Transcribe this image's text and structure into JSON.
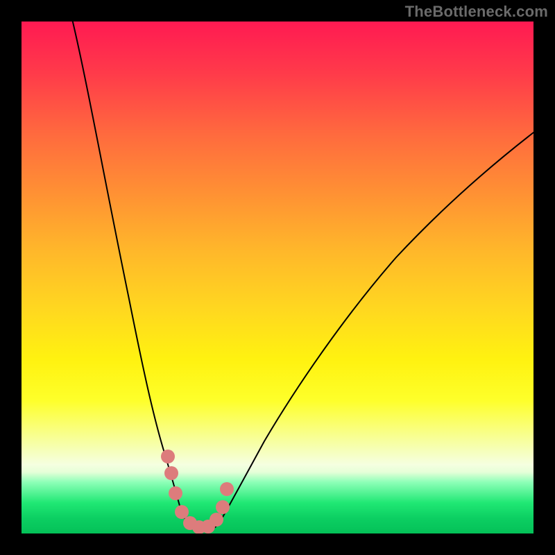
{
  "watermark": "TheBottleneck.com",
  "colors": {
    "frame_border": "#000000",
    "curve_stroke": "#000000",
    "marker_fill": "#dd7c7c",
    "gradient_top": "#ff1a52",
    "gradient_mid": "#fff210",
    "gradient_bottom": "#04c158"
  },
  "chart_data": {
    "type": "line",
    "title": "",
    "xlabel": "",
    "ylabel": "",
    "xlim": [
      0,
      100
    ],
    "ylim": [
      0,
      100
    ],
    "grid": false,
    "series": [
      {
        "name": "bottleneck-curve",
        "x": [
          10,
          12,
          14,
          16,
          18,
          20,
          22,
          24,
          26,
          28,
          29.5,
          31,
          33,
          35,
          37,
          40,
          45,
          50,
          55,
          60,
          65,
          70,
          75,
          80,
          85,
          90,
          95,
          100
        ],
        "values": [
          100,
          89,
          79,
          69,
          59,
          50,
          41,
          33,
          25,
          17,
          12,
          7,
          3,
          1,
          0.5,
          1,
          4,
          9,
          15,
          22,
          30,
          38,
          46,
          54,
          62,
          69,
          75,
          80
        ]
      }
    ],
    "markers": {
      "name": "highlighted-points",
      "x": [
        28,
        29,
        30,
        31.5,
        33,
        34.5,
        36,
        37.5,
        38.5,
        39
      ],
      "values": [
        16,
        12.5,
        8,
        4.5,
        2,
        1,
        1,
        2.5,
        5,
        9
      ]
    },
    "annotations": [
      {
        "text": "TheBottleneck.com",
        "position": "top-right"
      }
    ]
  }
}
